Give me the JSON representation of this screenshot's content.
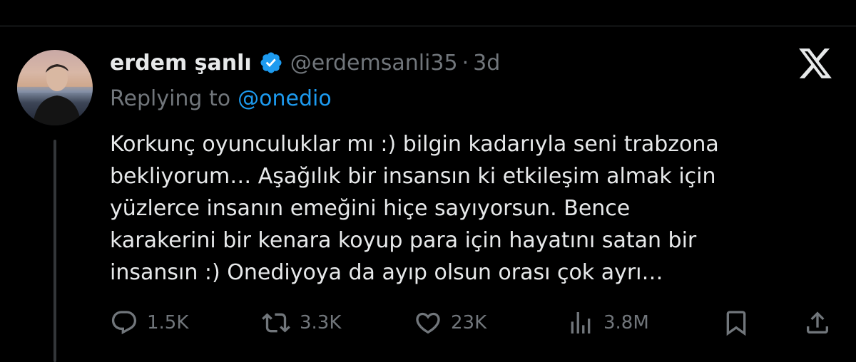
{
  "tweet": {
    "author": {
      "display_name": "erdem şanlı",
      "handle": "@erdemsanli35",
      "time_ago": "3d",
      "dot": "·"
    },
    "replying": {
      "label": "Replying to",
      "mention": "@onedio"
    },
    "text_lines": [
      "Korkunç oyunculuklar mı :) bilgin kadarıyla seni trabzona",
      "bekliyorum… Aşağılık bir insansın ki etkileşim almak için",
      "yüzlerce insanın emeğini hiçe sayıyorsun. Bence",
      "karakerini bir kenara koyup para için hayatını satan bir",
      "insansın :) Onediyoya da ayıp olsun orası çok ayrı…"
    ],
    "stats": {
      "replies": "1.5K",
      "reposts": "3.3K",
      "likes": "23K",
      "views": "3.8M"
    }
  },
  "icons": {
    "verified": "verified-badge-icon",
    "platform": "x-logo-icon",
    "reply": "reply-icon",
    "repost": "repost-icon",
    "like": "heart-icon",
    "views": "views-icon",
    "bookmark": "bookmark-icon",
    "share": "share-icon"
  },
  "colors": {
    "background": "#000000",
    "text": "#e7e9ea",
    "muted": "#71767b",
    "accent": "#1d9bf0"
  }
}
